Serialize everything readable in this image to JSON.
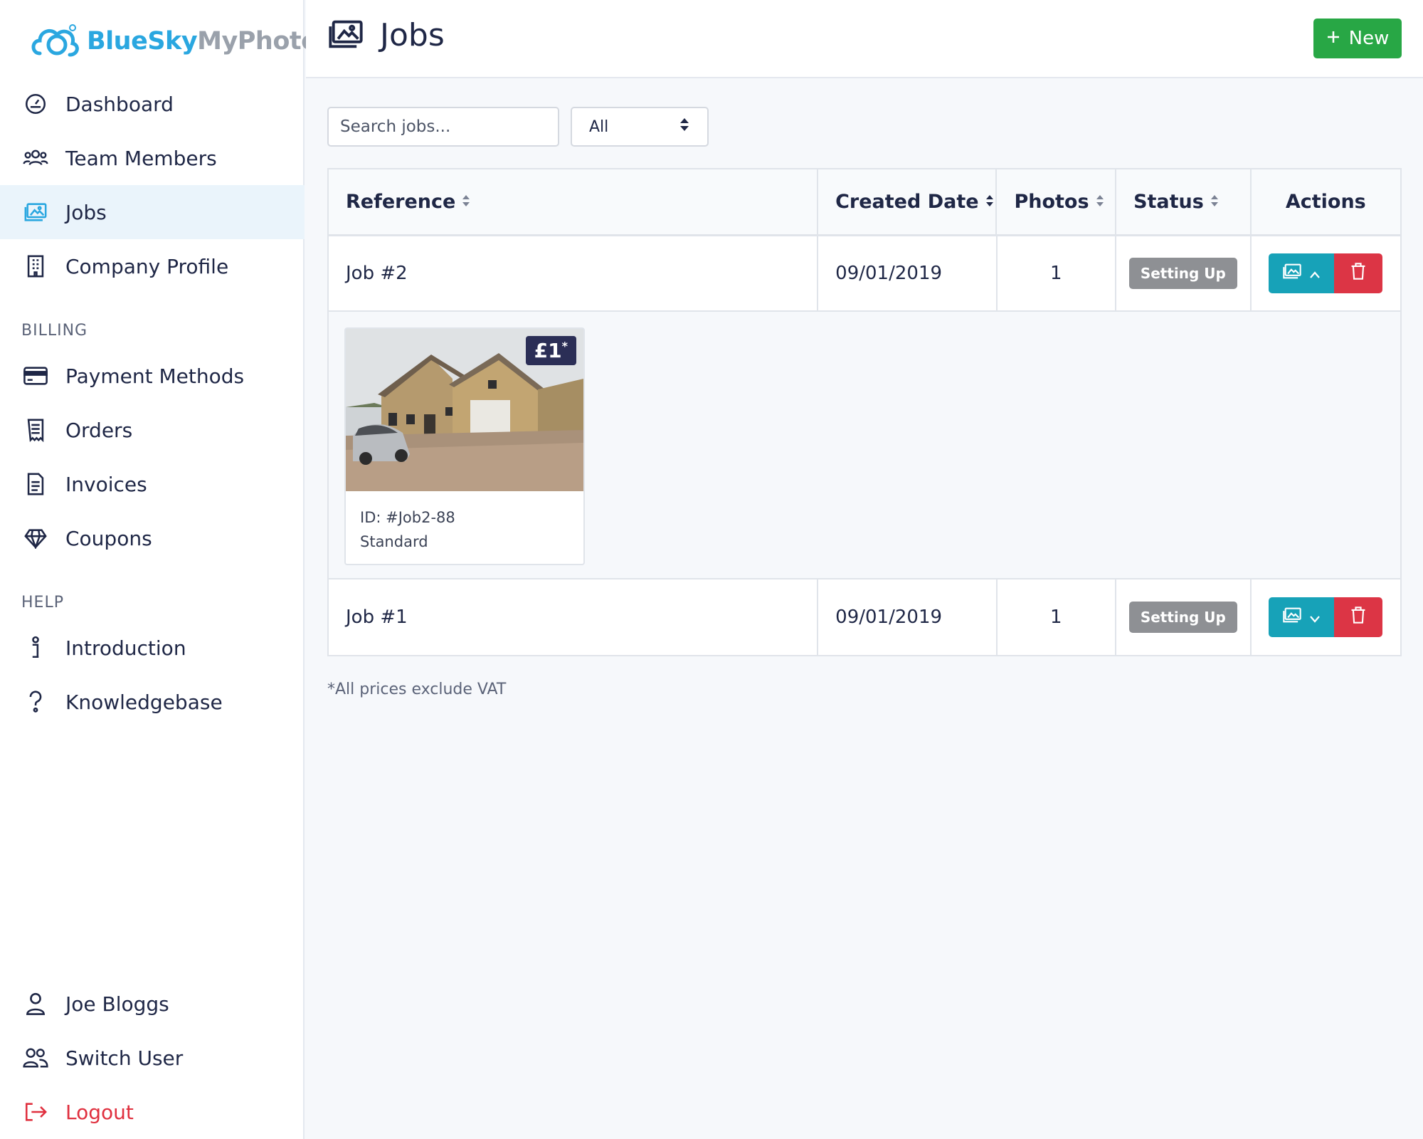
{
  "brand": {
    "part1": "BlueSky",
    "part2": "MyPhoto"
  },
  "sidebar": {
    "main": [
      {
        "label": "Dashboard",
        "icon": "dashboard-icon"
      },
      {
        "label": "Team Members",
        "icon": "team-icon"
      },
      {
        "label": "Jobs",
        "icon": "images-icon",
        "active": true
      },
      {
        "label": "Company Profile",
        "icon": "building-icon"
      }
    ],
    "billing_heading": "BILLING",
    "billing": [
      {
        "label": "Payment Methods",
        "icon": "credit-card-icon"
      },
      {
        "label": "Orders",
        "icon": "receipt-icon"
      },
      {
        "label": "Invoices",
        "icon": "invoice-icon"
      },
      {
        "label": "Coupons",
        "icon": "diamond-icon"
      }
    ],
    "help_heading": "HELP",
    "help": [
      {
        "label": "Introduction",
        "icon": "info-icon"
      },
      {
        "label": "Knowledgebase",
        "icon": "question-icon"
      }
    ],
    "footer": [
      {
        "label": "Joe Bloggs",
        "icon": "user-icon"
      },
      {
        "label": "Switch User",
        "icon": "users-icon"
      },
      {
        "label": "Logout",
        "icon": "logout-icon"
      }
    ]
  },
  "header": {
    "title": "Jobs",
    "new_label": "New"
  },
  "filters": {
    "search_placeholder": "Search jobs...",
    "status_selected": "All"
  },
  "table": {
    "columns": [
      "Reference",
      "Created Date",
      "Photos",
      "Status",
      "Actions"
    ],
    "rows": [
      {
        "reference": "Job #2",
        "created": "09/01/2019",
        "photos": "1",
        "status": "Setting Up",
        "expanded": true
      },
      {
        "reference": "Job #1",
        "created": "09/01/2019",
        "photos": "1",
        "status": "Setting Up",
        "expanded": false
      }
    ],
    "expanded_photo": {
      "price": "£1",
      "price_suffix": "*",
      "id_line": "ID: #Job2-88",
      "type_line": "Standard"
    }
  },
  "footnote": "*All prices exclude VAT",
  "colors": {
    "accent": "#2aa7e0",
    "new_button": "#28a745",
    "photos_button": "#17a2b8",
    "delete_button": "#dc3545",
    "badge": "#8e9094",
    "logout": "#e0303f"
  }
}
